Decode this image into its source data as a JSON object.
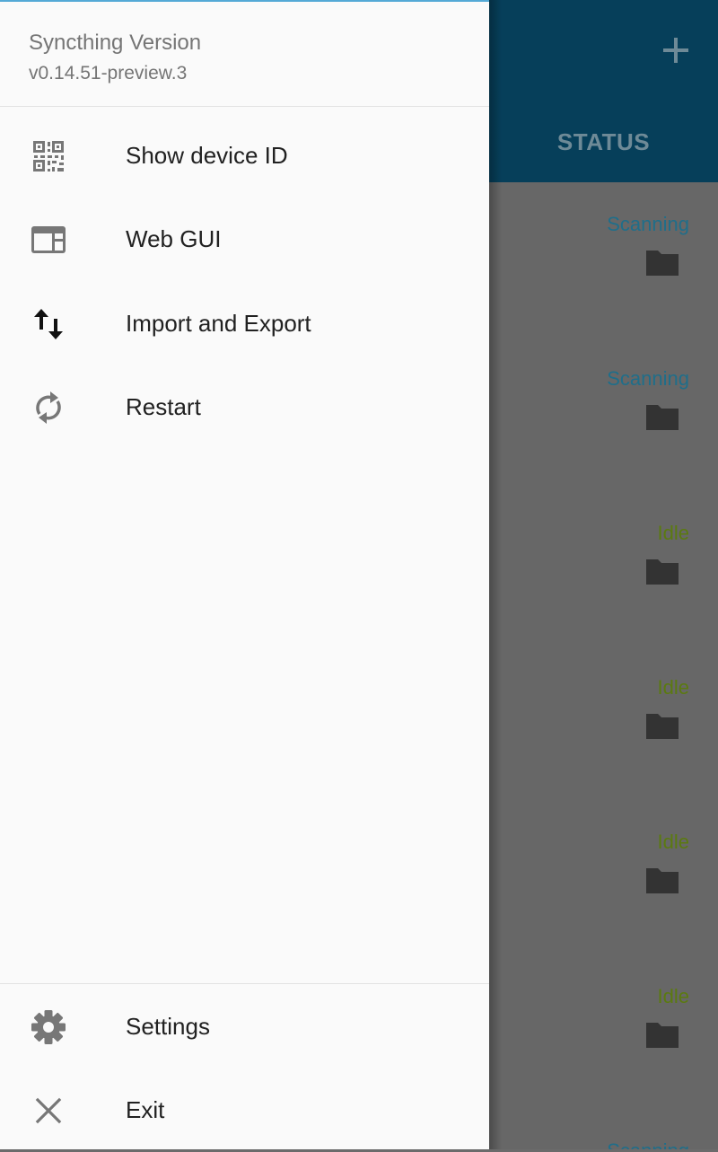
{
  "app": {
    "add_icon": "plus-icon",
    "tab_label": "STATUS",
    "folders": [
      {
        "status": "Scanning",
        "color": "#1f6e8a"
      },
      {
        "status": "Scanning",
        "color": "#1f6e8a"
      },
      {
        "status": "Idle",
        "color": "#5b7a10"
      },
      {
        "status": "Idle",
        "color": "#5b7a10"
      },
      {
        "status": "Idle",
        "color": "#5b7a10"
      },
      {
        "status": "Idle",
        "color": "#5b7a10"
      },
      {
        "status": "Scanning",
        "color": "#1f6e8a"
      }
    ]
  },
  "drawer": {
    "header": {
      "title": "Syncthing Version",
      "version": "v0.14.51-preview.3"
    },
    "items": [
      {
        "label": "Show device ID",
        "icon": "qr-code-icon"
      },
      {
        "label": "Web GUI",
        "icon": "web-window-icon"
      },
      {
        "label": "Import and Export",
        "icon": "import-export-icon"
      },
      {
        "label": "Restart",
        "icon": "restart-icon"
      }
    ],
    "footer_items": [
      {
        "label": "Settings",
        "icon": "gear-icon"
      },
      {
        "label": "Exit",
        "icon": "close-icon"
      }
    ]
  },
  "colors": {
    "appbar": "#063f5a",
    "scanning": "#1f6e8a",
    "idle": "#5b7a10",
    "drawer_bg": "#fafafa"
  }
}
